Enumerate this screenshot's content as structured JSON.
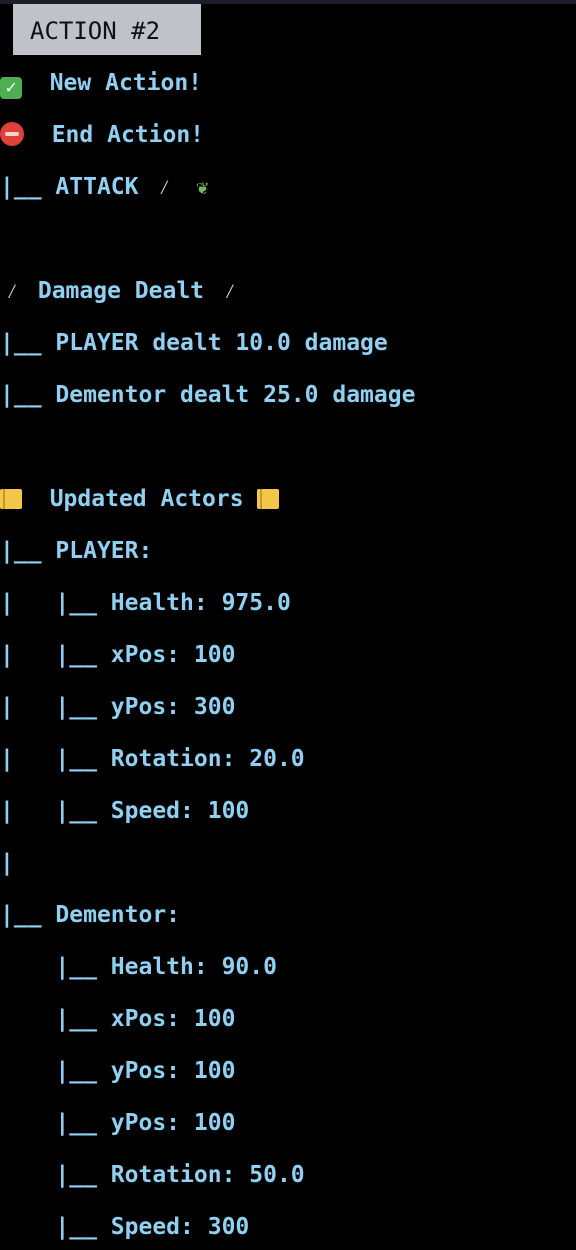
{
  "header": {
    "badge": "ACTION #2"
  },
  "icons": {
    "check": "check-mark-icon",
    "stop": "stop-sign-icon",
    "wand": "magic-wand-icon",
    "leaf": "leaf-icon",
    "sword": "sword-icon",
    "ledger": "ledger-icon"
  },
  "colors": {
    "text": "#8fd0f3",
    "background": "#000000",
    "badge_bg": "#bfc3c9"
  },
  "log": {
    "new_action": "New Action!",
    "end_action": "End Action!",
    "attack_prefix": "|__",
    "attack": "ATTACK",
    "damage_title": "Damage Dealt",
    "damage": [
      {
        "prefix": "|__",
        "text": "PLAYER dealt 10.0 damage"
      },
      {
        "prefix": "|__",
        "text": "Dementor dealt 25.0 damage"
      }
    ],
    "actors_title": "Updated Actors",
    "player": {
      "prefix": "|__",
      "name": "PLAYER:",
      "stats": [
        {
          "prefix": "|   |__",
          "text": "Health: 975.0"
        },
        {
          "prefix": "|   |__",
          "text": "xPos: 100"
        },
        {
          "prefix": "|   |__",
          "text": "yPos: 300"
        },
        {
          "prefix": "|   |__",
          "text": "Rotation: 20.0"
        },
        {
          "prefix": "|   |__",
          "text": "Speed: 100"
        }
      ],
      "trail": "|"
    },
    "dementor": {
      "prefix": "|__",
      "name": "Dementor:",
      "stats": [
        {
          "prefix": "    |__",
          "text": "Health: 90.0"
        },
        {
          "prefix": "    |__",
          "text": "xPos: 100"
        },
        {
          "prefix": "    |__",
          "text": "yPos: 100"
        },
        {
          "prefix": "    |__",
          "text": "yPos: 100"
        },
        {
          "prefix": "    |__",
          "text": "Rotation: 50.0"
        },
        {
          "prefix": "    |__",
          "text": "Speed: 300"
        }
      ]
    }
  }
}
